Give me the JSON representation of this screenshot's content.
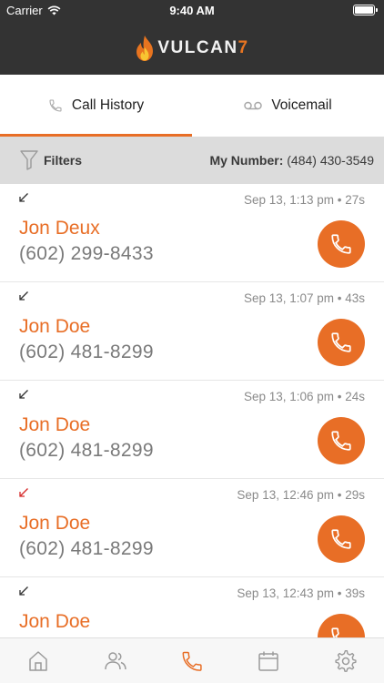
{
  "status_bar": {
    "carrier": "Carrier",
    "time": "9:40 AM"
  },
  "brand": {
    "name": "VULCAN",
    "suffix": "7",
    "accent": "#e86e26"
  },
  "tabs": [
    {
      "label": "Call History",
      "icon": "phone-icon",
      "active": true
    },
    {
      "label": "Voicemail",
      "icon": "voicemail-icon",
      "active": false
    }
  ],
  "filter_bar": {
    "filters_label": "Filters",
    "my_number_label": "My Number:",
    "my_number_value": "(484) 430-3549"
  },
  "calls": [
    {
      "direction": "incoming",
      "direction_color": "#333333",
      "meta": "Sep 13, 1:13 pm • 27s",
      "name": "Jon Deux",
      "phone": "(602) 299-8433"
    },
    {
      "direction": "incoming",
      "direction_color": "#333333",
      "meta": "Sep 13, 1:07 pm • 43s",
      "name": "Jon Doe",
      "phone": "(602) 481-8299"
    },
    {
      "direction": "incoming",
      "direction_color": "#333333",
      "meta": "Sep 13, 1:06 pm • 24s",
      "name": "Jon Doe",
      "phone": "(602) 481-8299"
    },
    {
      "direction": "missed",
      "direction_color": "#d62b2b",
      "meta": "Sep 13, 12:46 pm • 29s",
      "name": "Jon Doe",
      "phone": "(602) 481-8299"
    },
    {
      "direction": "incoming",
      "direction_color": "#333333",
      "meta": "Sep 13, 12:43 pm • 39s",
      "name": "Jon Doe",
      "phone": ""
    }
  ],
  "bottom_nav": [
    {
      "icon": "home-icon",
      "active": false
    },
    {
      "icon": "contacts-icon",
      "active": false
    },
    {
      "icon": "phone-icon",
      "active": true
    },
    {
      "icon": "calendar-icon",
      "active": false
    },
    {
      "icon": "settings-icon",
      "active": false
    }
  ]
}
